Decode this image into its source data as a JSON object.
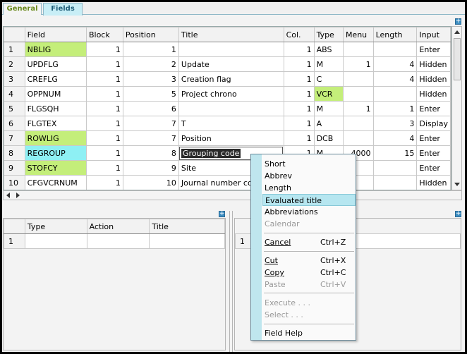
{
  "tabs": [
    {
      "label": "General",
      "active": false
    },
    {
      "label": "Fields",
      "active": true
    }
  ],
  "fields_grid": {
    "columns": [
      "Field",
      "Block",
      "Position",
      "Title",
      "Col.",
      "Type",
      "Menu",
      "Length",
      "Input"
    ],
    "rows": [
      {
        "n": "1",
        "field": "NBLIG",
        "block": "1",
        "position": "1",
        "title": "",
        "col": "1",
        "type": "ABS",
        "menu": "",
        "length": "",
        "input": "Enter"
      },
      {
        "n": "2",
        "field": "UPDFLG",
        "block": "1",
        "position": "2",
        "title": "Update",
        "col": "1",
        "type": "M",
        "menu": "1",
        "length": "4",
        "input": "Hidden"
      },
      {
        "n": "3",
        "field": "CREFLG",
        "block": "1",
        "position": "3",
        "title": "Creation flag",
        "col": "1",
        "type": "C",
        "menu": "",
        "length": "4",
        "input": "Hidden"
      },
      {
        "n": "4",
        "field": "OPPNUM",
        "block": "1",
        "position": "5",
        "title": "Project chrono",
        "col": "1",
        "type": "VCR",
        "menu": "",
        "length": "",
        "input": "Hidden"
      },
      {
        "n": "5",
        "field": "FLGSQH",
        "block": "1",
        "position": "6",
        "title": "",
        "col": "1",
        "type": "M",
        "menu": "1",
        "length": "1",
        "input": "Enter"
      },
      {
        "n": "6",
        "field": "FLGTEX",
        "block": "1",
        "position": "7",
        "title": "T",
        "col": "1",
        "type": "A",
        "menu": "",
        "length": "3",
        "input": "Display"
      },
      {
        "n": "7",
        "field": "ROWLIG",
        "block": "1",
        "position": "7",
        "title": "Position",
        "col": "1",
        "type": "DCB",
        "menu": "",
        "length": "4",
        "input": "Enter"
      },
      {
        "n": "8",
        "field": "REGROUP",
        "block": "1",
        "position": "8",
        "title": "Grouping code",
        "col": "1",
        "type": "M",
        "menu": "4000",
        "length": "15",
        "input": "Enter"
      },
      {
        "n": "9",
        "field": "STOFCY",
        "block": "1",
        "position": "9",
        "title": "Site",
        "col": "1",
        "type": "",
        "menu": "",
        "length": "",
        "input": "Enter"
      },
      {
        "n": "10",
        "field": "CFGVCRNUM",
        "block": "1",
        "position": "10",
        "title": "Journal number con",
        "col": "1",
        "type": "",
        "menu": "",
        "length": "",
        "input": "Hidden"
      }
    ]
  },
  "actions_grid": {
    "columns": [
      "Type",
      "Action",
      "Title"
    ],
    "rows": [
      {
        "n": "1"
      }
    ]
  },
  "right_grid": {
    "rows": [
      {
        "n": "1"
      }
    ]
  },
  "context_menu": {
    "items": [
      {
        "label": "Short",
        "shortcut": "",
        "disabled": false
      },
      {
        "label": "Abbrev",
        "shortcut": "",
        "disabled": false
      },
      {
        "label": "Length",
        "shortcut": "",
        "disabled": false
      },
      {
        "label": "Evaluated title",
        "shortcut": "",
        "disabled": false,
        "highlighted": true
      },
      {
        "label": "Abbreviations",
        "shortcut": "",
        "disabled": false
      },
      {
        "label": "Calendar",
        "shortcut": "",
        "disabled": true
      },
      {
        "label": "Cancel",
        "shortcut": "Ctrl+Z",
        "disabled": false
      },
      {
        "label": "Cut",
        "shortcut": "Ctrl+X",
        "disabled": false
      },
      {
        "label": "Copy",
        "shortcut": "Ctrl+C",
        "disabled": false
      },
      {
        "label": "Paste",
        "shortcut": "Ctrl+V",
        "disabled": true
      },
      {
        "label": "Execute . . .",
        "shortcut": "",
        "disabled": true
      },
      {
        "label": "Select . . .",
        "shortcut": "",
        "disabled": true
      },
      {
        "label": "Field Help",
        "shortcut": "",
        "disabled": false
      }
    ]
  },
  "colors": {
    "green_cell": "#c4ee7a",
    "cyan_cell": "#8ef0f4",
    "menu_highlight": "#b6e6f0"
  }
}
